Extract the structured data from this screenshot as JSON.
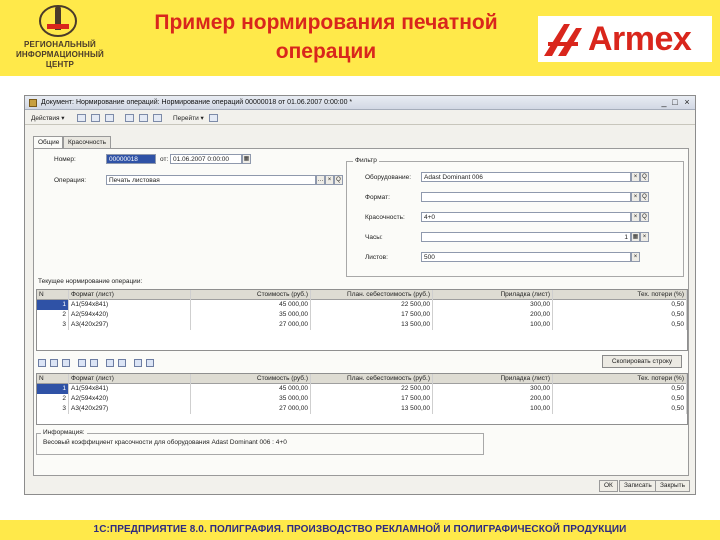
{
  "slide": {
    "logo_text": [
      "РЕГИОНАЛЬНЫЙ",
      "ИНФОРМАЦИОННЫЙ",
      "ЦЕНТР"
    ],
    "title_line1": "Пример нормирования печатной",
    "title_line2": "операции",
    "brand": "Armex",
    "footer": "1С:ПРЕДПРИЯТИЕ 8.0. ПОЛИГРАФИЯ. ПРОИЗВОДСТВО РЕКЛАМНОЙ И ПОЛИГРАФИЧЕСКОЙ ПРОДУКЦИИ",
    "colors": {
      "band": "#ffe94a",
      "title": "#d9261c",
      "footer": "#2d2a80"
    }
  },
  "window": {
    "title": "Документ: Нормирование операций: Нормирование операций 00000018 от 01.06.2007 0:00:00 *",
    "controls": {
      "minimize": "_",
      "maximize": "□",
      "close": "×"
    },
    "toolbar": {
      "actions": "Действия ▾",
      "goto": "Перейти ▾"
    },
    "tabs": [
      "Общие",
      "Красочность"
    ],
    "form": {
      "number_label": "Номер:",
      "number_value": "00000018",
      "date_label": "от:",
      "date_value": "01.06.2007 0:00:00",
      "operation_label": "Операция:",
      "operation_value": "Печать листовая"
    },
    "filter": {
      "title": "Фильтр",
      "equipment_label": "Оборудование:",
      "equipment_value": "Adast Dominant 006",
      "format_label": "Формат:",
      "format_value": "",
      "color_label": "Красочность:",
      "color_value": "4+0",
      "hours_label": "Часы:",
      "hours_value": "1",
      "sheets_label": "Листов:",
      "sheets_value": "500"
    },
    "current_norms_label": "Текущее нормирование операции:",
    "columns": [
      "N",
      "Формат (лист)",
      "Стоимость (руб.)",
      "План. себестоимость (руб.)",
      "Приладка (лист)",
      "Тех. потери (%)"
    ],
    "rows1": [
      [
        "1",
        "A1(594x841)",
        "45 000,00",
        "22 500,00",
        "300,00",
        "0,50"
      ],
      [
        "2",
        "A2(594x420)",
        "35 000,00",
        "17 500,00",
        "200,00",
        "0,50"
      ],
      [
        "3",
        "A3(420x297)",
        "27 000,00",
        "13 500,00",
        "100,00",
        "0,50"
      ]
    ],
    "copy_button": "Скопировать строку",
    "rows2": [
      [
        "1",
        "A1(594x841)",
        "45 000,00",
        "22 500,00",
        "300,00",
        "0,50"
      ],
      [
        "2",
        "A2(594x420)",
        "35 000,00",
        "17 500,00",
        "200,00",
        "0,50"
      ],
      [
        "3",
        "A3(420x297)",
        "27 000,00",
        "13 500,00",
        "100,00",
        "0,50"
      ]
    ],
    "info": {
      "title": "Информация:",
      "text": "Весовый коэффициент красочности для оборудования Adast Dominant 006 : 4+0"
    },
    "bottom": {
      "ok": "ОК",
      "save": "Записать",
      "close": "Закрыть"
    }
  }
}
